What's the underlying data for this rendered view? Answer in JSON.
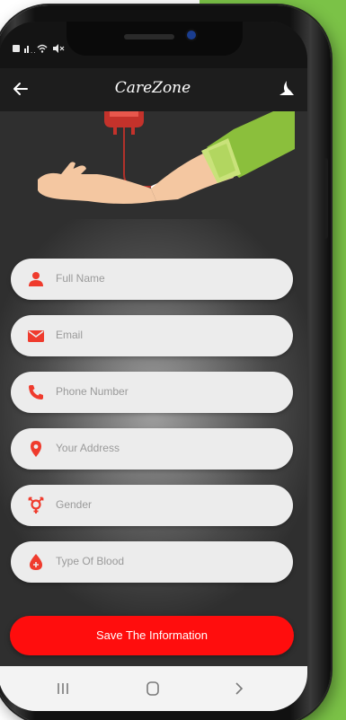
{
  "app": {
    "title": "CareZone"
  },
  "status_bar": {
    "icons": [
      "image-icon",
      "signal-icon",
      "wifi-icon",
      "mute-icon"
    ]
  },
  "form": {
    "fields": [
      {
        "placeholder": "Full Name",
        "icon": "person-icon"
      },
      {
        "placeholder": "Email",
        "icon": "email-icon"
      },
      {
        "placeholder": "Phone Number",
        "icon": "phone-icon"
      },
      {
        "placeholder": "Your Address",
        "icon": "location-pin-icon"
      },
      {
        "placeholder": "Gender",
        "icon": "gender-icon"
      },
      {
        "placeholder": "Type Of Blood",
        "icon": "blood-drop-icon"
      }
    ],
    "save_label": "Save The Information"
  },
  "nav": {
    "items": [
      "recent-apps-icon",
      "home-icon",
      "back-icon"
    ]
  },
  "colors": {
    "accent": "#ff0d0d",
    "background_green": "#7bc247",
    "app_bar": "#1d1d1d",
    "screen_bg": "#2f2f2f",
    "field_bg": "#ececec"
  }
}
